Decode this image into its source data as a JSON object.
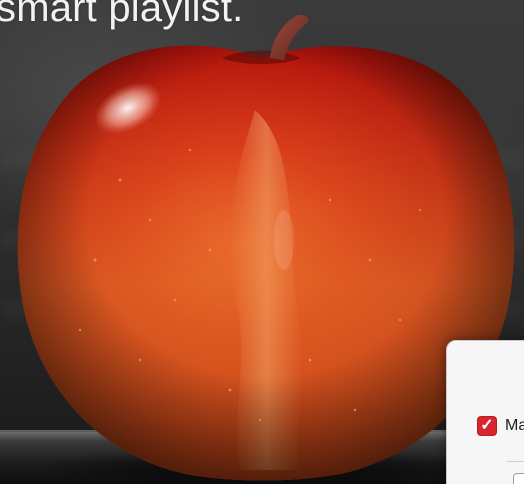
{
  "slide": {
    "title": "smart playlist."
  },
  "dialog": {
    "match_checkbox_checked": true,
    "match_label": "Ma",
    "accent_color": "#d8252d"
  },
  "photo": {
    "subject": "red-apple-icon",
    "apple_color": "#c81e12",
    "highlight_color": "#f5a37a"
  }
}
